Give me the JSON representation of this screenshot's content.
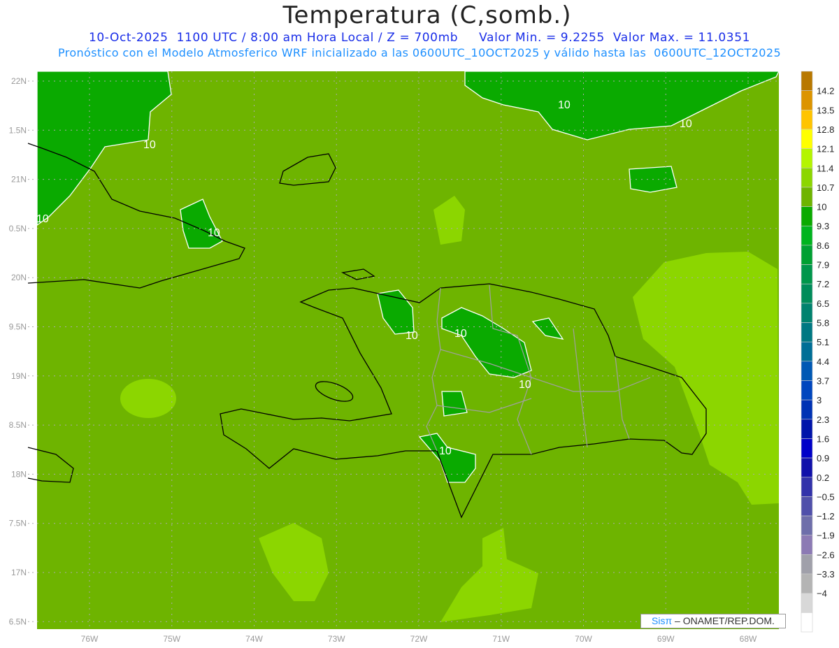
{
  "header": {
    "title": "Temperatura (C,somb.)",
    "line1": "10-Oct-2025  1100 UTC / 8:00 am Hora Local / Z = 700mb     Valor Min. = 9.2255  Valor Max. = 11.0351",
    "line2": "Pronóstico con el Modelo Atmosferico WRF inicializado a las 0600UTC_10OCT2025 y válido hasta las  0600UTC_12OCT2025"
  },
  "map": {
    "lat_labels": [
      "22N",
      "1.5N",
      "21N",
      "0.5N",
      "20N",
      "9.5N",
      "19N",
      "8.5N",
      "18N",
      "7.5N",
      "17N",
      "6.5N"
    ],
    "lon_labels": [
      "76W",
      "75W",
      "74W",
      "73W",
      "72W",
      "71W",
      "70W",
      "69W",
      "68W"
    ],
    "contour_label": "10",
    "colors": {
      "base": "#6eb400",
      "below10": "#0aaa00",
      "above10_7": "#8cd600",
      "coast": "#000000",
      "contour": "#ffffff",
      "borders": "#a0a0a0"
    }
  },
  "colorbar": {
    "labels": [
      "14.2",
      "13.5",
      "12.8",
      "12.1",
      "11.4",
      "10.7",
      "10",
      "9.3",
      "8.6",
      "7.9",
      "7.2",
      "6.5",
      "5.8",
      "5.1",
      "4.4",
      "3.7",
      "3",
      "2.3",
      "1.6",
      "0.9",
      "0.2",
      "−0.5",
      "−1.2",
      "−1.9",
      "−2.6",
      "−3.3",
      "−4"
    ],
    "colors": [
      "#b87800",
      "#dc9400",
      "#ffc400",
      "#ffff00",
      "#b4f500",
      "#8cd600",
      "#6eb400",
      "#0aaa00",
      "#00b41e",
      "#00a032",
      "#00964b",
      "#008c5a",
      "#00826e",
      "#007882",
      "#006e96",
      "#0058b4",
      "#0046be",
      "#0032b4",
      "#0014aa",
      "#0000c8",
      "#1010aa",
      "#3232aa",
      "#5050aa",
      "#6e6eaa",
      "#8c7ab4",
      "#a0a0aa",
      "#b4b4b4",
      "#d8d8d8",
      "#ffffff"
    ]
  },
  "credit": {
    "brand": "Sisπ",
    "text": " – ONAMET/REP.DOM."
  }
}
